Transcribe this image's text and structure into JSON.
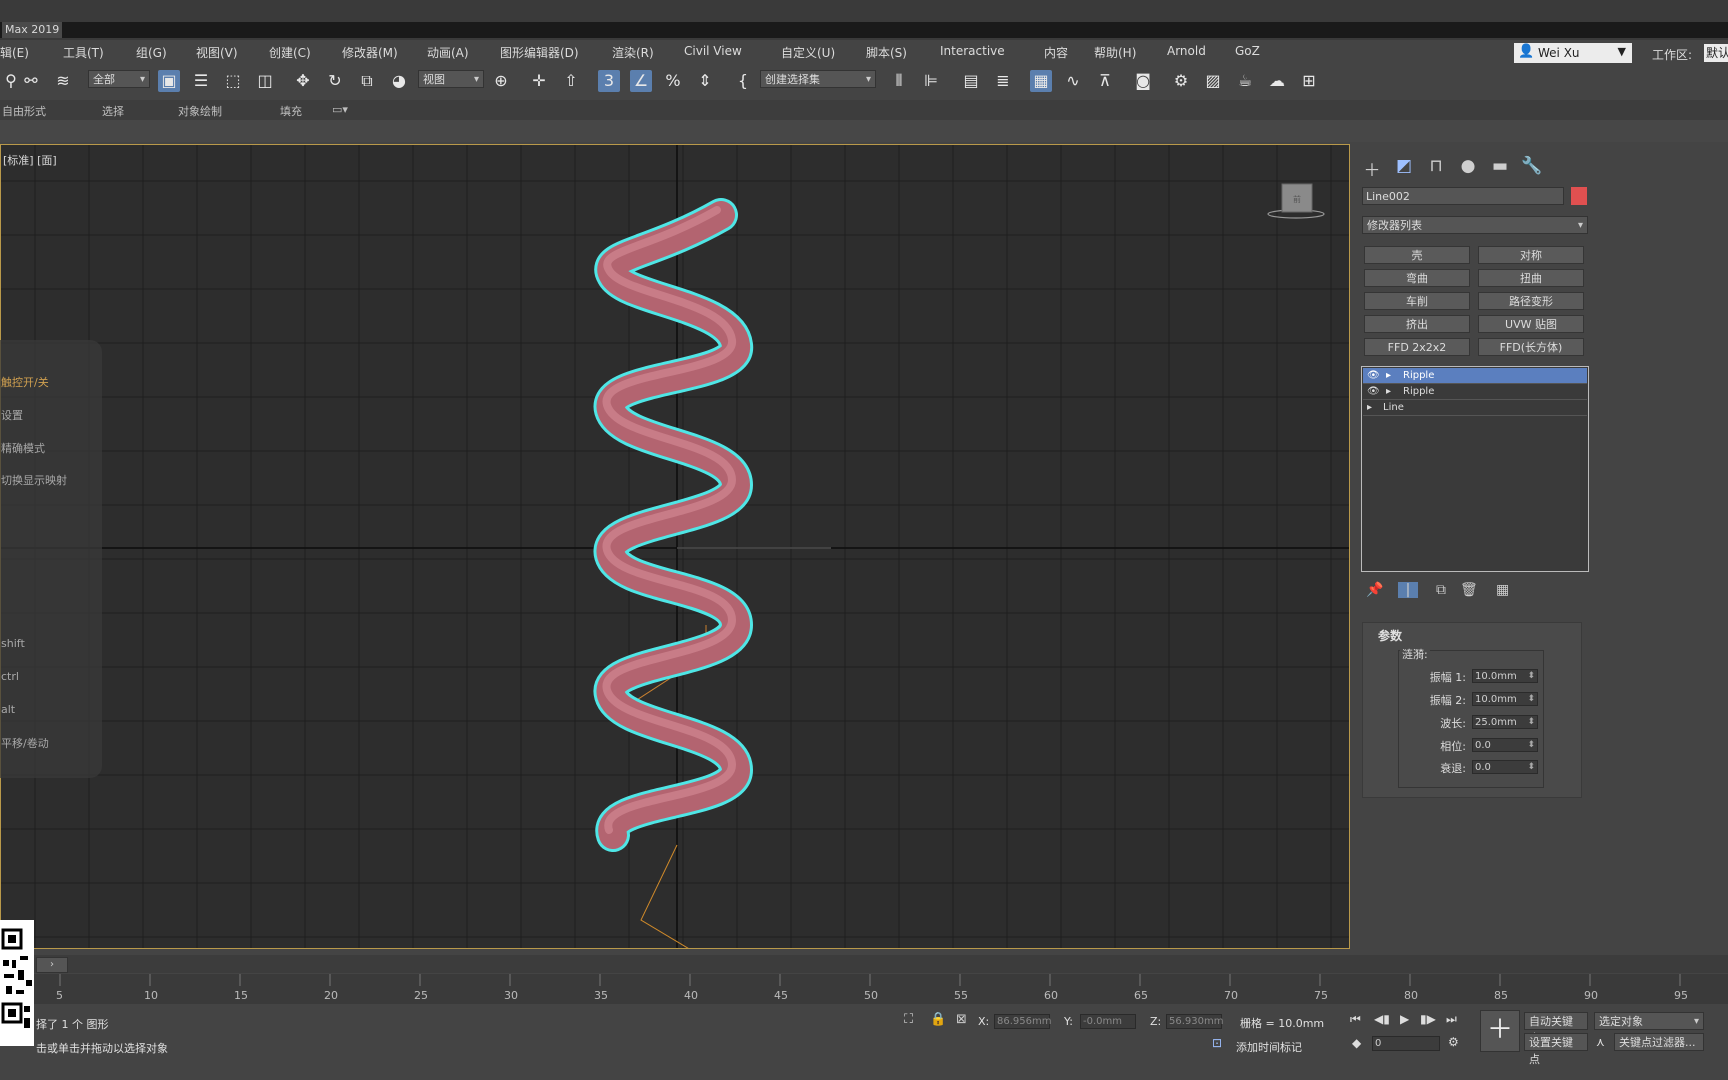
{
  "app": {
    "title": "Max 2019"
  },
  "menu": [
    "辑(E)",
    "工具(T)",
    "组(G)",
    "视图(V)",
    "创建(C)",
    "修改器(M)",
    "动画(A)",
    "图形编辑器(D)",
    "渲染(R)",
    "Civil View",
    "自定义(U)",
    "脚本(S)",
    "Interactive",
    "内容",
    "帮助(H)",
    "Arnold",
    "GoZ"
  ],
  "user": {
    "name": "Wei Xu",
    "workspace_label": "工作区:",
    "workspace_value": "默认"
  },
  "toolbar": {
    "filter_dropdown": "全部",
    "refcoord_dropdown": "视图",
    "selection_set_dropdown": "创建选择集",
    "icons": [
      "link-icon",
      "unlink-icon",
      "bind-space-warp-icon",
      "select-icon",
      "select-by-name-icon",
      "rect-region-icon",
      "window-crossing-icon",
      "move-icon",
      "rotate-icon",
      "scale-icon",
      "place-icon",
      "pivot-icon",
      "manipulate-icon",
      "keyboard-shortcut-icon",
      "snap-3d-icon",
      "angle-snap-icon",
      "percent-snap-icon",
      "spinner-snap-icon",
      "edit-named-sets-icon",
      "mirror-icon",
      "align-icon",
      "scene-explorer-icon",
      "layer-explorer-icon",
      "toggle-ribbon-icon",
      "curve-editor-icon",
      "dope-sheet-icon",
      "material-editor-icon",
      "render-setup-icon",
      "rendered-frame-icon",
      "render-icon",
      "render-cloud-icon",
      "render-online-icon",
      "a360-icon"
    ]
  },
  "ribbon": {
    "tabs": [
      "自由形式",
      "选择",
      "对象绘制",
      "填充"
    ]
  },
  "viewport": {
    "label": "[标准] [面]",
    "overlay_items": [
      "触控开/关",
      "设置",
      "精确模式",
      "切换显示映射",
      "shift",
      "ctrl",
      "alt",
      "平移/卷动"
    ]
  },
  "command_panel": {
    "tabs": [
      "create-tab",
      "modify-tab",
      "hierarchy-tab",
      "motion-tab",
      "display-tab",
      "utilities-tab"
    ],
    "object_name": "Line002",
    "object_color": "#e05050",
    "modifier_list": "修改器列表",
    "modifier_buttons": [
      "壳",
      "对称",
      "弯曲",
      "扭曲",
      "车削",
      "路径变形",
      "挤出",
      "UVW 贴图",
      "FFD 2x2x2",
      "FFD(长方体)"
    ],
    "stack": [
      {
        "label": "Ripple",
        "selected": true,
        "eye": true
      },
      {
        "label": "Ripple",
        "selected": false,
        "eye": true
      },
      {
        "label": "Line",
        "selected": false,
        "eye": false
      }
    ],
    "params": {
      "title": "参数",
      "group_label": "涟漪:",
      "fields": [
        {
          "label": "振幅 1:",
          "value": "10.0mm"
        },
        {
          "label": "振幅 2:",
          "value": "10.0mm"
        },
        {
          "label": "波长:",
          "value": "25.0mm"
        },
        {
          "label": "相位:",
          "value": "0.0"
        },
        {
          "label": "衰退:",
          "value": "0.0"
        }
      ]
    }
  },
  "timeline": {
    "ticks": [
      "5",
      "10",
      "15",
      "20",
      "25",
      "30",
      "35",
      "40",
      "45",
      "50",
      "55",
      "60",
      "65",
      "70",
      "75",
      "80",
      "85",
      "90",
      "95"
    ]
  },
  "status": {
    "selected": "择了 1 个 图形",
    "prompt": "击或单击并拖动以选择对象",
    "x_label": "X:",
    "x_value": "86.956mm",
    "y_label": "Y:",
    "y_value": "-0.0mm",
    "z_label": "Z:",
    "z_value": "56.930mm",
    "grid": "栅格 = 10.0mm",
    "add_time_tag": "添加时间标记",
    "auto_key": "自动关键点",
    "set_key": "设置关键点",
    "selected_dropdown": "选定对象",
    "key_filters": "关键点过滤器...",
    "frame": "0"
  }
}
